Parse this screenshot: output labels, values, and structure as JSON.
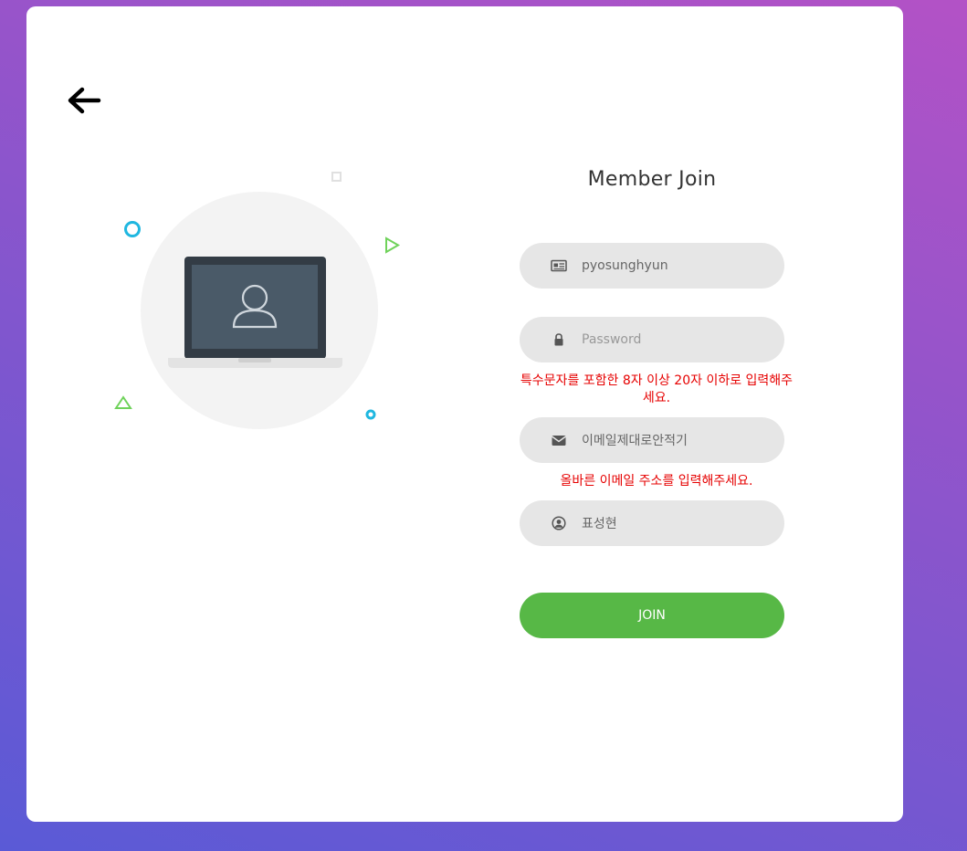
{
  "page": {
    "title": "Member Join"
  },
  "form": {
    "id_value": "pyosunghyun",
    "password_placeholder": "Password",
    "password_error": "특수문자를 포함한 8자 이상 20자 이하로 입력해주세요.",
    "email_value": "이메일제대로안적기",
    "email_error": "올바른 이메일 주소를 입력해주세요.",
    "name_value": "표성현",
    "join_label": "JOIN"
  },
  "icons": {
    "back": "arrow-left-icon",
    "id": "id-card-icon",
    "password": "lock-icon",
    "email": "envelope-icon",
    "name": "user-circle-icon"
  },
  "colors": {
    "background_start": "#b352c6",
    "background_end": "#5a5ad6",
    "join_button": "#57b846",
    "error_text": "#e60000",
    "input_background": "#e6e6e6"
  }
}
